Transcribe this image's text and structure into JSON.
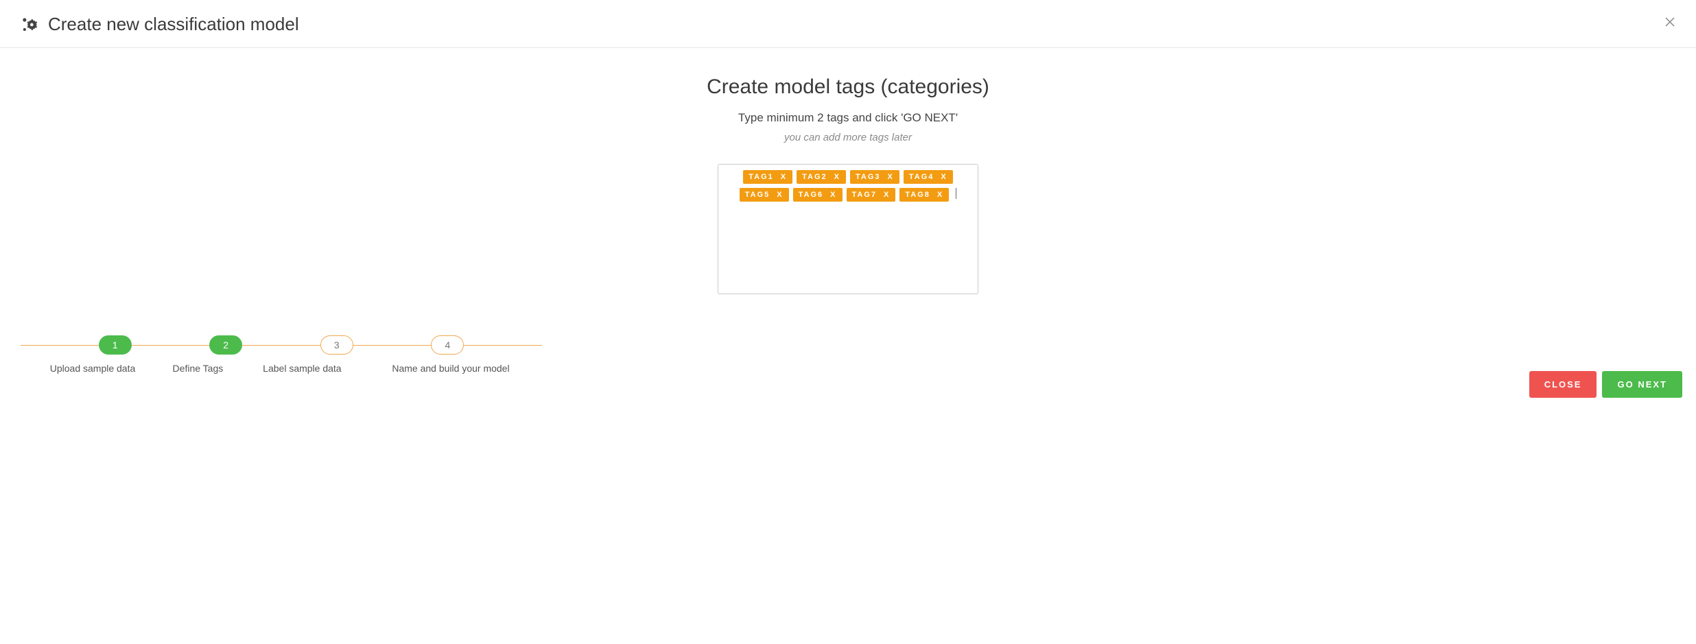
{
  "header": {
    "title": "Create new classification model"
  },
  "main": {
    "heading": "Create model tags (categories)",
    "subheading": "Type minimum 2 tags and click 'GO NEXT'",
    "note": "you can add more tags later",
    "tags": [
      "TAG1",
      "TAG2",
      "TAG3",
      "TAG4",
      "TAG5",
      "TAG6",
      "TAG7",
      "TAG8"
    ],
    "tag_remove_glyph": "X"
  },
  "stepper": {
    "steps": [
      {
        "num": "1",
        "label": "Upload sample data",
        "done": true
      },
      {
        "num": "2",
        "label": "Define Tags",
        "done": true
      },
      {
        "num": "3",
        "label": "Label sample data",
        "done": false
      },
      {
        "num": "4",
        "label": "Name and build your model",
        "done": false
      }
    ]
  },
  "footer": {
    "close_label": "CLOSE",
    "next_label": "GO NEXT"
  },
  "colors": {
    "accent_orange": "#f39c12",
    "step_green": "#4cbb4c",
    "close_red": "#ef5350"
  }
}
